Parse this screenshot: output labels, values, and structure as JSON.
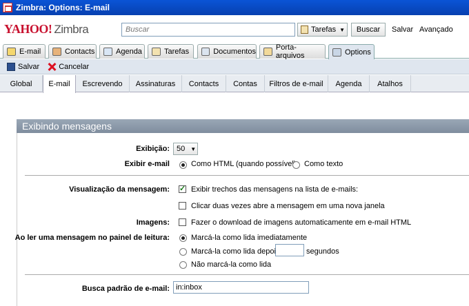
{
  "window": {
    "title": "Zimbra: Options: E-mail"
  },
  "header": {
    "logo_yahoo": "YAHOO!",
    "logo_zimbra": "Zimbra",
    "search_placeholder": "Buscar",
    "search_type": "Tarefas",
    "search_button": "Buscar",
    "save_link": "Salvar",
    "advanced_link": "Avançado"
  },
  "app_tabs": [
    {
      "label": "E-mail",
      "icon": "mail-icon"
    },
    {
      "label": "Contacts",
      "icon": "contacts-icon"
    },
    {
      "label": "Agenda",
      "icon": "calendar-icon"
    },
    {
      "label": "Tarefas",
      "icon": "tasks-icon"
    },
    {
      "label": "Documentos",
      "icon": "documents-icon"
    },
    {
      "label": "Porta-arquivos",
      "icon": "briefcase-icon"
    },
    {
      "label": "Options",
      "icon": "options-icon",
      "active": true
    }
  ],
  "toolbar": {
    "save": "Salvar",
    "cancel": "Cancelar"
  },
  "sub_tabs": [
    "Global",
    "E-mail",
    "Escrevendo",
    "Assinaturas",
    "Contacts",
    "Contas",
    "Filtros de e-mail",
    "Agenda",
    "Atalhos"
  ],
  "section": {
    "title": "Exibindo mensagens",
    "display_label": "Exibição:",
    "display_value": "50",
    "show_email_label": "Exibir e-mail",
    "show_html": "Como HTML (quando possível)",
    "show_text": "Como texto",
    "preview_label": "Visualização da mensagem:",
    "preview_snippets": "Exibir trechos das mensagens na lista de e-mails:",
    "preview_doubleclick": "Clicar duas vezes abre a mensagem em uma nova janela",
    "images_label": "Imagens:",
    "images_download": "Fazer o download de imagens automaticamente em e-mail HTML",
    "reading_label": "Ao ler uma mensagem no painel de leitura:",
    "mark_immediately": "Marcá-la como lida imediatamente",
    "mark_after": "Marcá-la como lida depois de",
    "mark_after_seconds": "",
    "seconds": "segundos",
    "mark_never": "Não marcá-la como lida",
    "default_search_label": "Busca padrão de e-mail:",
    "default_search_value": "in:inbox"
  },
  "colors": {
    "titlebar": "#0a54d6",
    "section_bar": "#8a97a8",
    "toolbar_bg": "#dfe6ef"
  }
}
